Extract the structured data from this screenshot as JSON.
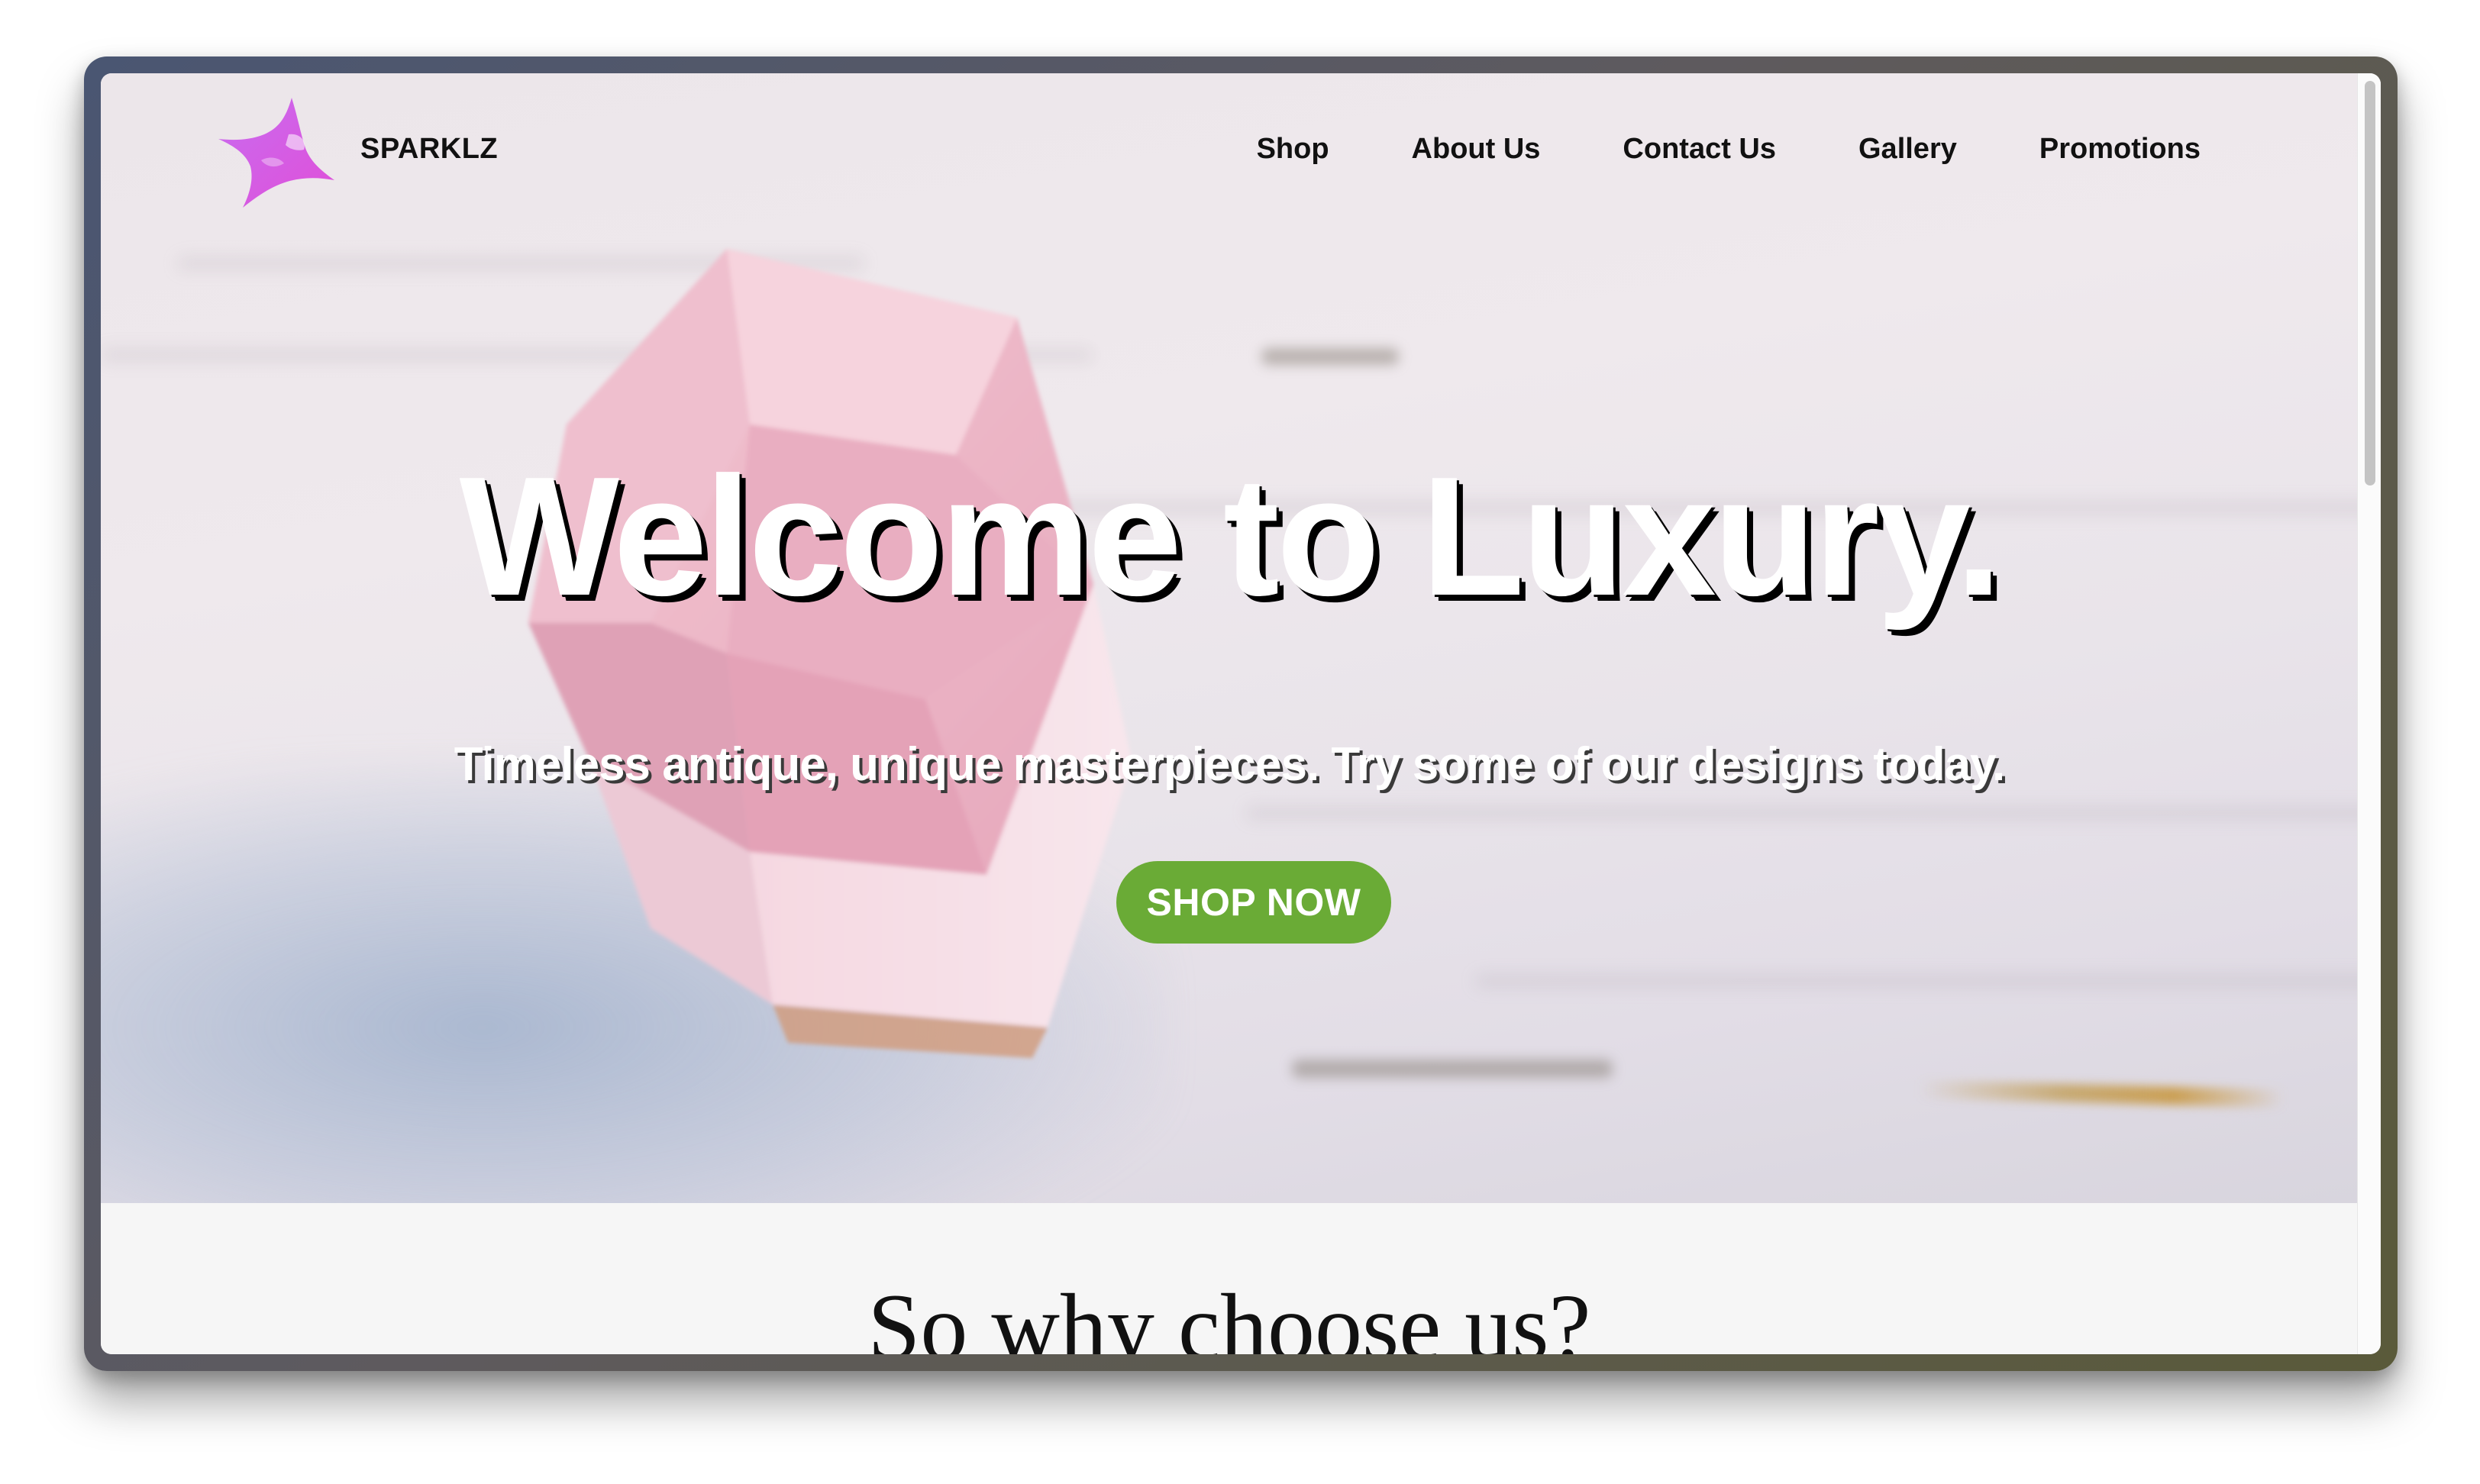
{
  "brand": {
    "name": "SPARKLZ",
    "logo_icon": "star-sparkle-logo-icon"
  },
  "nav": {
    "items": [
      {
        "label": "Shop"
      },
      {
        "label": "About Us"
      },
      {
        "label": "Contact Us"
      },
      {
        "label": "Gallery"
      },
      {
        "label": "Promotions"
      }
    ]
  },
  "hero": {
    "headline": "Welcome to Luxury.",
    "subheadline": "Timeless antique, unique masterpieces. Try some of our designs today.",
    "cta_label": "SHOP NOW",
    "cta_color": "#6aab36",
    "image_subject": "rose-quartz-crystal-photo"
  },
  "section": {
    "title": "So why choose us?"
  },
  "colors": {
    "logo_gradient_start": "#c86cf0",
    "logo_gradient_end": "#e04fd8",
    "text": "#111111"
  }
}
